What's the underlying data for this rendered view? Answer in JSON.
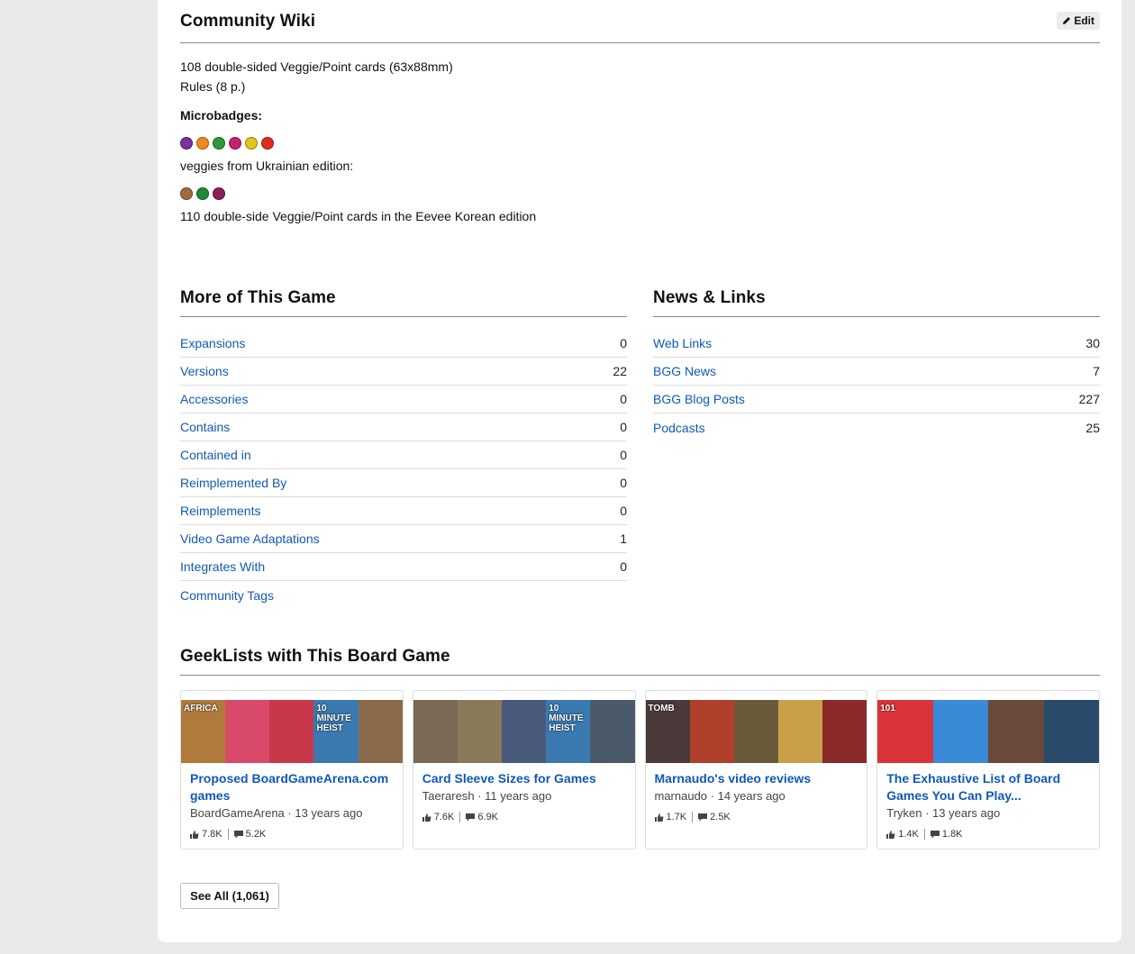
{
  "wiki": {
    "title": "Community Wiki",
    "edit_label": "Edit",
    "line1": "108 double-sided Veggie/Point cards (63x88mm)",
    "line2": "Rules (8 p.)",
    "microbadges_label": "Microbadges:",
    "microbadges": [
      {
        "icon": "cabbage-icon",
        "color": "#7b2fa0"
      },
      {
        "icon": "carrot-icon",
        "color": "#f08a1c"
      },
      {
        "icon": "pepper-icon",
        "color": "#2e9a3a"
      },
      {
        "icon": "onion-icon",
        "color": "#c2236f"
      },
      {
        "icon": "corn-icon",
        "color": "#e6c21a"
      },
      {
        "icon": "tomato-icon",
        "color": "#e02c1f"
      }
    ],
    "ukrainian_label": "veggies from Ukrainian edition:",
    "ukrainian_badges": [
      {
        "icon": "potato-icon",
        "color": "#a06a3a"
      },
      {
        "icon": "cabbage-green-icon",
        "color": "#1f8a35"
      },
      {
        "icon": "beet-icon",
        "color": "#8a1f5a"
      }
    ],
    "line3": "110 double-side Veggie/Point cards in the Eevee Korean edition"
  },
  "more": {
    "title": "More of This Game",
    "rows": [
      {
        "label": "Expansions",
        "count": "0"
      },
      {
        "label": "Versions",
        "count": "22"
      },
      {
        "label": "Accessories",
        "count": "0"
      },
      {
        "label": "Contains",
        "count": "0"
      },
      {
        "label": "Contained in",
        "count": "0"
      },
      {
        "label": "Reimplemented By",
        "count": "0"
      },
      {
        "label": "Reimplements",
        "count": "0"
      },
      {
        "label": "Video Game Adaptations",
        "count": "1"
      },
      {
        "label": "Integrates With",
        "count": "0"
      },
      {
        "label": "Community Tags",
        "count": ""
      }
    ]
  },
  "news": {
    "title": "News & Links",
    "rows": [
      {
        "label": "Web Links",
        "count": "30"
      },
      {
        "label": "BGG News",
        "count": "7"
      },
      {
        "label": "BGG Blog Posts",
        "count": "227"
      },
      {
        "label": "Podcasts",
        "count": "25"
      }
    ]
  },
  "geeklists": {
    "title": "GeekLists with This Board Game",
    "see_all": "See All (1,061)",
    "items": [
      {
        "title": "Proposed BoardGameArena.com games",
        "author": "BoardGameArena · 13 years ago",
        "thumbs": [
          "AFRICA",
          "",
          "",
          "10 MINUTE HEIST",
          ""
        ],
        "thumb_colors": [
          "#b07a3c",
          "#d94a6a",
          "#c8384a",
          "#3a7ab0",
          "#8a6a4a"
        ],
        "likes": "7.8K",
        "comments": "5.2K"
      },
      {
        "title": "Card Sleeve Sizes for Games",
        "author": "Taeraresh · 11 years ago",
        "thumbs": [
          "",
          "",
          "",
          "10 MINUTE HEIST",
          ""
        ],
        "thumb_colors": [
          "#7a6a55",
          "#8a7a5a",
          "#4a5a7a",
          "#3a7ab0",
          "#4a5a6a"
        ],
        "likes": "7.6K",
        "comments": "6.9K"
      },
      {
        "title": "Marnaudo's video reviews",
        "author": "marnaudo · 14 years ago",
        "thumbs": [
          "TOMB",
          "",
          "",
          "",
          ""
        ],
        "thumb_colors": [
          "#4a3a3a",
          "#b0402a",
          "#6a5a3a",
          "#c8a04a",
          "#8a2a2a"
        ],
        "likes": "1.7K",
        "comments": "2.5K"
      },
      {
        "title": "The Exhaustive List of Board Games You Can Play...",
        "author": "Tryken · 13 years ago",
        "thumbs": [
          "101",
          "",
          "",
          ""
        ],
        "thumb_colors": [
          "#d8343a",
          "#3a8ad8",
          "#6a4a3a",
          "#2a4a6a"
        ],
        "likes": "1.4K",
        "comments": "1.8K"
      }
    ]
  },
  "colors": {
    "link": "#1059b5",
    "divider": "#888888"
  }
}
